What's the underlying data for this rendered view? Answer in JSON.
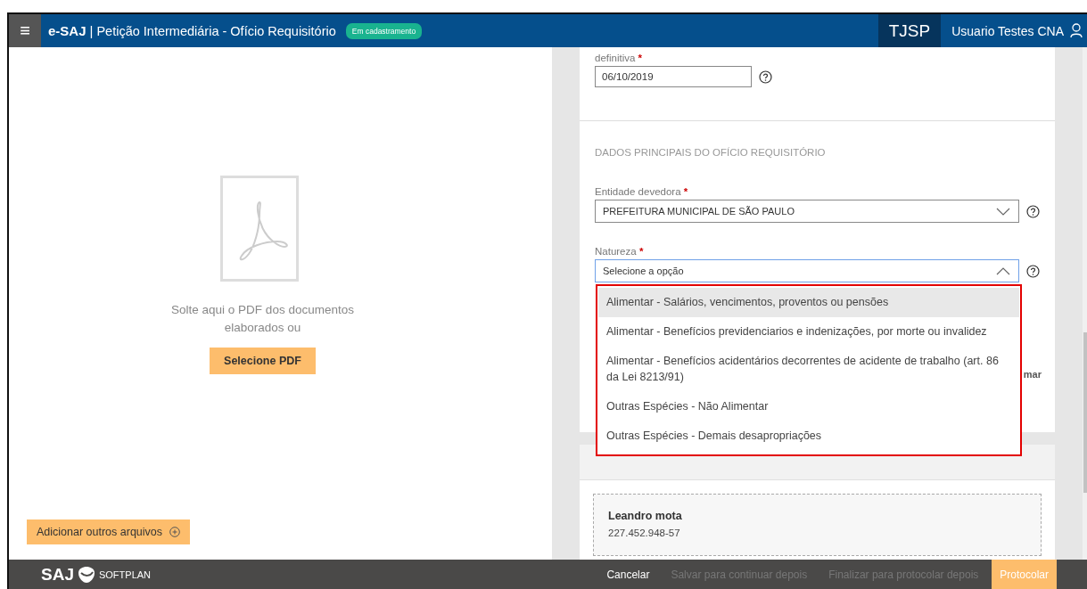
{
  "header": {
    "menu_icon": "≡",
    "app": "e-SAJ",
    "separator": "|",
    "title": "Petição Intermediária - Ofício Requisitório",
    "status_badge": "Em cadastramento",
    "court": "TJSP",
    "user": "Usuario Testes CNA"
  },
  "upload": {
    "drop_text": "Solte aqui o PDF dos documentos elaborados ou",
    "select_button": "Selecione PDF",
    "add_button": "Adicionar outros arquivos"
  },
  "form": {
    "date_field": {
      "label": "definitiva",
      "required_mark": "*",
      "value": "06/10/2019"
    },
    "section_title": "DADOS PRINCIPAIS DO OFÍCIO REQUISITÓRIO",
    "entity_field": {
      "label": "Entidade devedora",
      "required_mark": "*",
      "value": "PREFEITURA MUNICIPAL DE SÃO PAULO",
      "expanded": false
    },
    "nature_field": {
      "label": "Natureza",
      "required_mark": "*",
      "placeholder": "Selecione a opção",
      "expanded": true,
      "options": [
        {
          "label": "Alimentar - Salários, vencimentos, proventos ou pensões",
          "selected": true
        },
        {
          "label": "Alimentar - Benefícios previdenciarios e indenizações, por morte ou invalidez",
          "selected": false
        },
        {
          "label": "Alimentar - Benefícios acidentários decorrentes de acidente de trabalho (art. 86 da Lei 8213/91)",
          "selected": false
        },
        {
          "label": "Outras Espécies - Não Alimentar",
          "selected": false
        },
        {
          "label": "Outras Espécies - Demais desapropriações",
          "selected": false
        }
      ]
    },
    "hidden_link": "mar",
    "party": {
      "name": "Leandro mota",
      "document": "227.452.948-57"
    }
  },
  "footer": {
    "logo": "SAJ",
    "brand": "SOFTPLAN",
    "buttons": [
      {
        "label": "Cancelar",
        "disabled": false,
        "primary": false
      },
      {
        "label": "Salvar para continuar depois",
        "disabled": true,
        "primary": false
      },
      {
        "label": "Finalizar para protocolar depois",
        "disabled": true,
        "primary": false
      },
      {
        "label": "Protocolar",
        "disabled": false,
        "primary": true
      }
    ]
  }
}
